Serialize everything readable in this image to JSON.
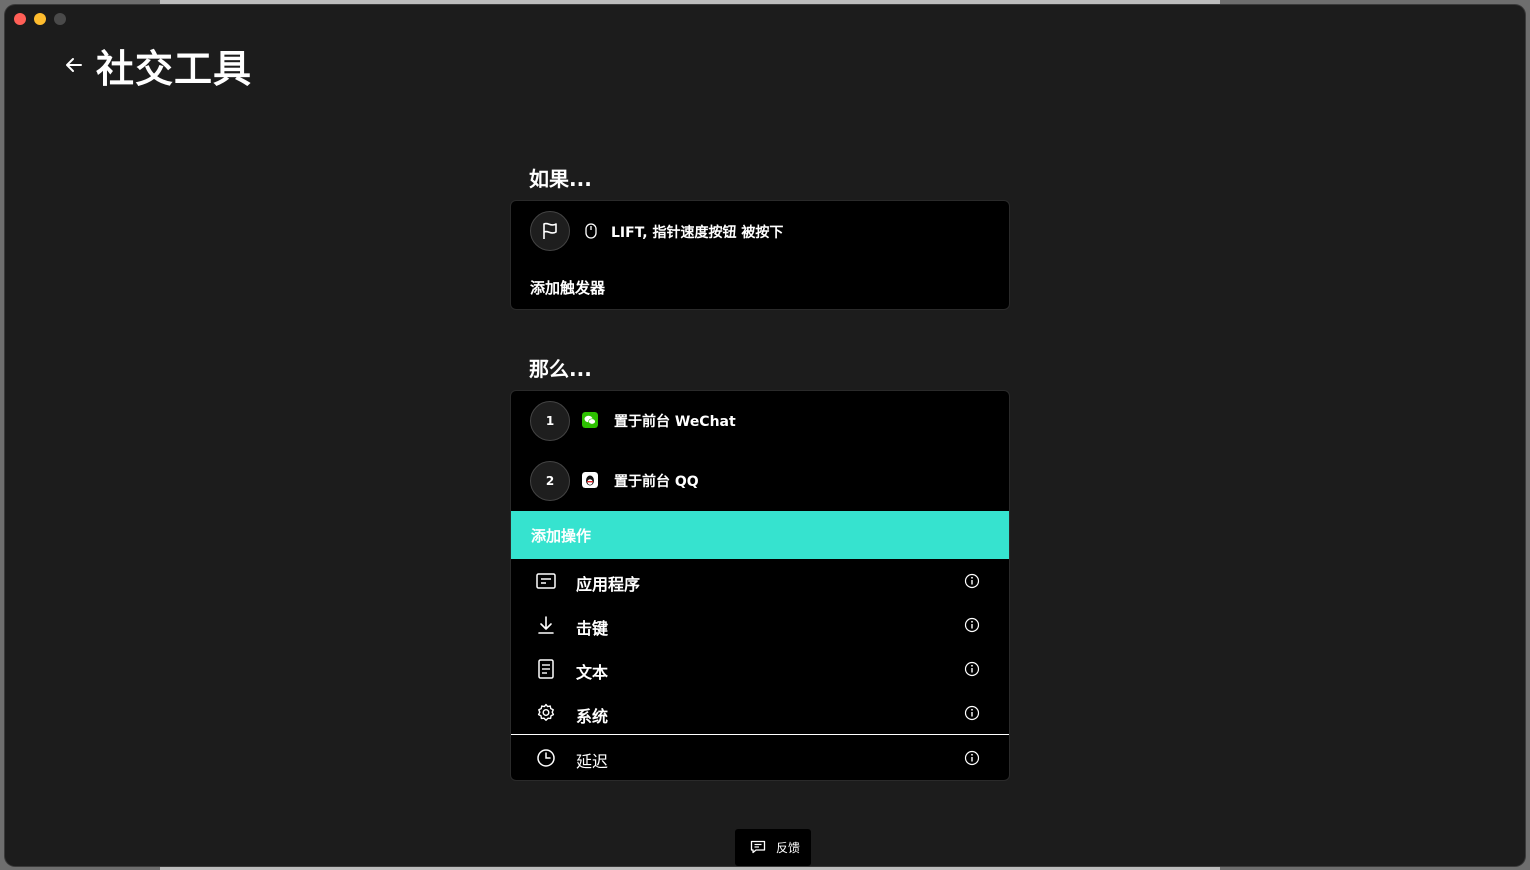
{
  "window": {
    "title": "社交工具"
  },
  "if_section": {
    "label": "如果...",
    "trigger": {
      "text": "LIFT, 指针速度按钮 被按下",
      "icon": "flag-icon",
      "device_icon": "mouse-icon"
    },
    "add_trigger_label": "添加触发器"
  },
  "then_section": {
    "label": "那么...",
    "steps": [
      {
        "number": "1",
        "text": "置于前台 WeChat",
        "icon": "wechat-icon",
        "color": "#2dc100"
      },
      {
        "number": "2",
        "text": "置于前台 QQ",
        "icon": "qq-icon",
        "color": "#ffffff"
      }
    ],
    "add_action_label": "添加操作",
    "accent_color": "#36e3cf",
    "menu": [
      {
        "label": "应用程序",
        "icon": "application-icon"
      },
      {
        "label": "击键",
        "icon": "keystroke-icon"
      },
      {
        "label": "文本",
        "icon": "text-icon"
      },
      {
        "label": "系统",
        "icon": "gear-icon"
      },
      {
        "label": "延迟",
        "icon": "clock-icon"
      }
    ]
  },
  "feedback": {
    "label": "反馈"
  }
}
